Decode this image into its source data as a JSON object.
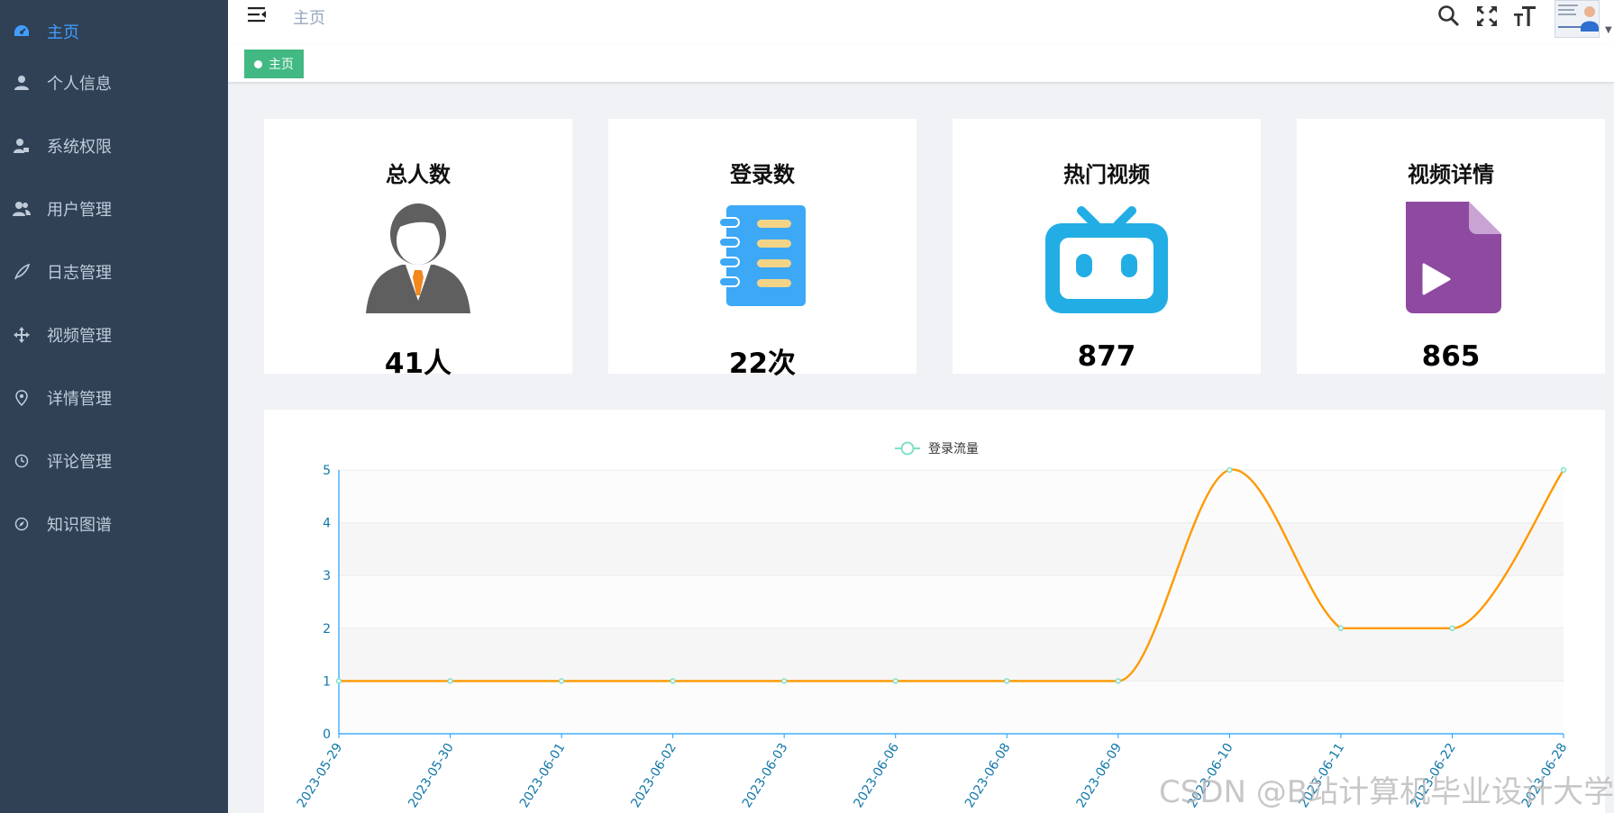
{
  "sidebar": {
    "items": [
      {
        "label": "主页",
        "icon": "dashboard-icon",
        "active": true
      },
      {
        "label": "个人信息",
        "icon": "user-icon",
        "active": false
      },
      {
        "label": "系统权限",
        "icon": "user-lock-icon",
        "active": false
      },
      {
        "label": "用户管理",
        "icon": "users-icon",
        "active": false
      },
      {
        "label": "日志管理",
        "icon": "feather-icon",
        "active": false
      },
      {
        "label": "视频管理",
        "icon": "move-arrows-icon",
        "active": false
      },
      {
        "label": "详情管理",
        "icon": "location-pin-icon",
        "active": false
      },
      {
        "label": "评论管理",
        "icon": "clock-icon",
        "active": false
      },
      {
        "label": "知识图谱",
        "icon": "compass-icon",
        "active": false
      }
    ]
  },
  "header": {
    "breadcrumb": "主页",
    "icons": [
      "search-icon",
      "fullscreen-icon",
      "font-size-icon"
    ]
  },
  "tags": {
    "active_tag": "主页"
  },
  "cards": [
    {
      "title": "总人数",
      "value": "41人",
      "icon": "person-suit-icon"
    },
    {
      "title": "登录数",
      "value": "22次",
      "icon": "notebook-icon"
    },
    {
      "title": "热门视频",
      "value": "877",
      "icon": "bilibili-tv-icon"
    },
    {
      "title": "视频详情",
      "value": "865",
      "icon": "video-file-icon"
    }
  ],
  "colors": {
    "sidebar_bg": "#304156",
    "active_menu": "#409eff",
    "tag_green": "#42b983",
    "line": "#ff9900",
    "axis": "#1e9fff",
    "point": "#7ee0c8"
  },
  "chart_data": {
    "type": "line",
    "series": [
      {
        "name": "登录流量",
        "values": [
          1,
          1,
          1,
          1,
          1,
          1,
          1,
          1,
          5,
          2,
          2,
          5
        ]
      }
    ],
    "categories": [
      "2023-05-29",
      "2023-05-30",
      "2023-06-01",
      "2023-06-02",
      "2023-06-03",
      "2023-06-06",
      "2023-06-08",
      "2023-06-09",
      "2023-06-10",
      "2023-06-11",
      "2023-06-22",
      "2023-06-28"
    ],
    "ylim": [
      0,
      5
    ],
    "yticks": [
      0,
      1,
      2,
      3,
      4,
      5
    ],
    "legend": "top-center",
    "smooth": true,
    "split_area": true
  },
  "watermark": "CSDN @B站计算机毕业设计大学"
}
